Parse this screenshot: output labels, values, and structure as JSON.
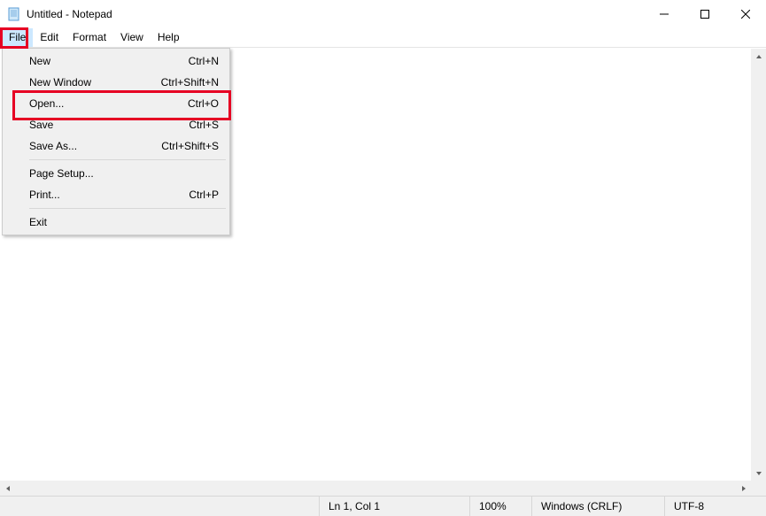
{
  "titlebar": {
    "title": "Untitled - Notepad"
  },
  "menubar": {
    "items": [
      "File",
      "Edit",
      "Format",
      "View",
      "Help"
    ]
  },
  "dropdown": {
    "items": [
      {
        "label": "New",
        "shortcut": "Ctrl+N"
      },
      {
        "label": "New Window",
        "shortcut": "Ctrl+Shift+N"
      },
      {
        "label": "Open...",
        "shortcut": "Ctrl+O"
      },
      {
        "label": "Save",
        "shortcut": "Ctrl+S"
      },
      {
        "label": "Save As...",
        "shortcut": "Ctrl+Shift+S"
      },
      {
        "label": "Page Setup...",
        "shortcut": ""
      },
      {
        "label": "Print...",
        "shortcut": "Ctrl+P"
      },
      {
        "label": "Exit",
        "shortcut": ""
      }
    ]
  },
  "statusbar": {
    "position": "Ln 1, Col 1",
    "zoom": "100%",
    "lineending": "Windows (CRLF)",
    "encoding": "UTF-8"
  }
}
